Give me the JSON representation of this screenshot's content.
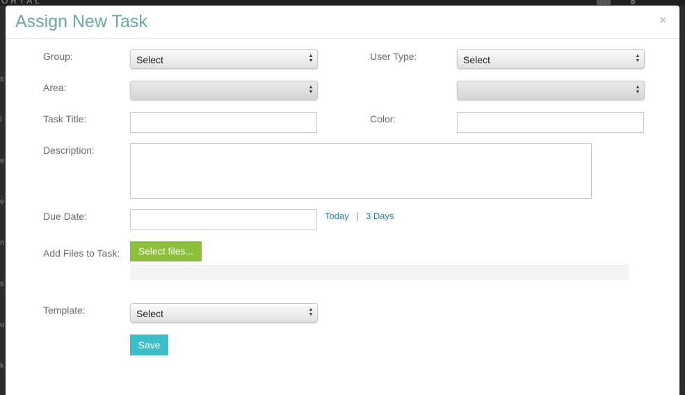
{
  "background": {
    "brand_partial": "ORTAL",
    "side_letters": [
      "s",
      "i",
      "e",
      "e",
      "n",
      "s",
      "u",
      "k"
    ]
  },
  "modal": {
    "title": "Assign New Task",
    "close_glyph": "×"
  },
  "form": {
    "group": {
      "label": "Group:",
      "value": "Select"
    },
    "user_type": {
      "label": "User Type:",
      "value": "Select"
    },
    "area": {
      "label": "Area:",
      "value": ""
    },
    "area_secondary": {
      "value": ""
    },
    "task_title": {
      "label": "Task Title:",
      "value": ""
    },
    "color": {
      "label": "Color:",
      "value": ""
    },
    "description": {
      "label": "Description:",
      "value": ""
    },
    "due_date": {
      "label": "Due Date:",
      "value": "",
      "shortcut_today": "Today",
      "separator": "|",
      "shortcut_3days": "3 Days"
    },
    "files": {
      "label": "Add Files to Task:",
      "button_label": "Select files..."
    },
    "template": {
      "label": "Template:",
      "value": "Select"
    },
    "save_label": "Save"
  },
  "colors": {
    "title": "#6aa6ad",
    "select_files_button": "#8dc03a",
    "save_button": "#3bbfc9",
    "link": "#2e7fa8"
  }
}
